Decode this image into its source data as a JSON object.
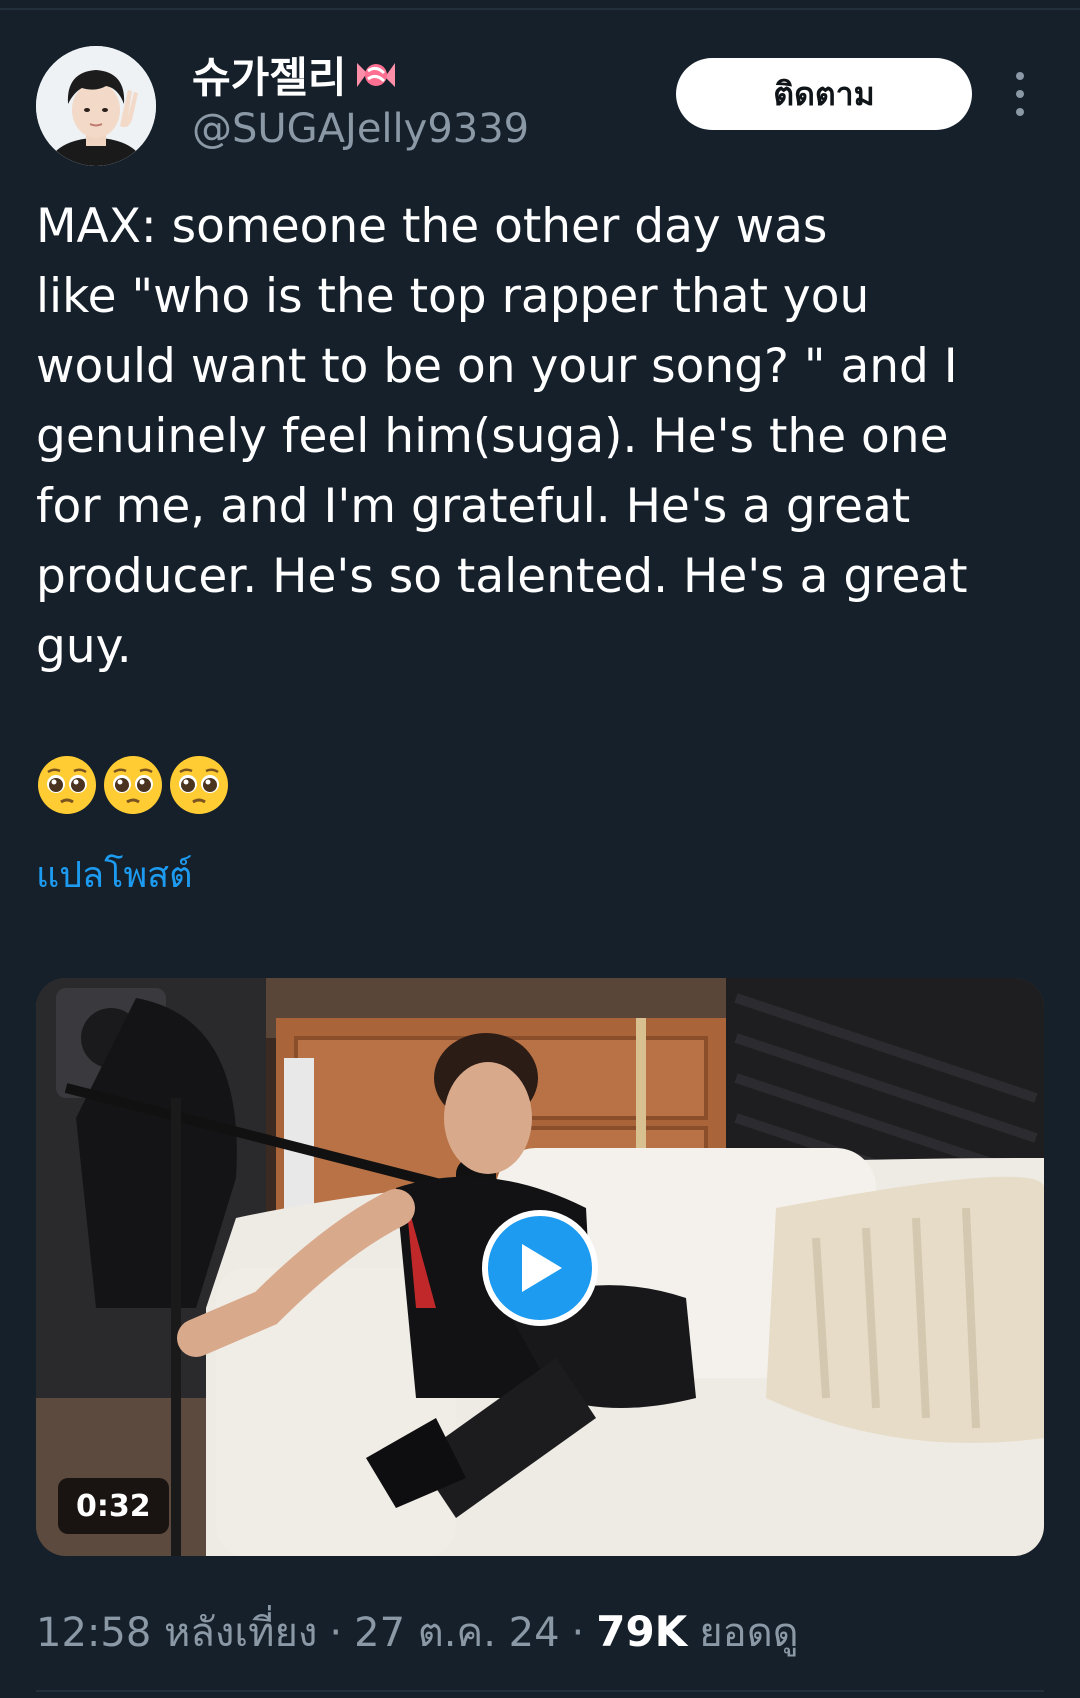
{
  "user": {
    "display_name": "슈가젤리",
    "display_emoji": "candy-emoji",
    "handle": "@SUGAJelly9339"
  },
  "header": {
    "follow_label": "ติดตาม",
    "more_icon": "more-vertical-icon"
  },
  "tweet": {
    "text": "MAX: someone the other day was\nlike \"who is the top rapper that you\nwould want to be on your song? \" and I\ngenuinely feel him(suga). He's the one\nfor me, and I'm grateful. He's a great\nproducer. He's so talented. He's a great\nguy.",
    "emojis": [
      "pleading-face-emoji",
      "pleading-face-emoji",
      "pleading-face-emoji"
    ],
    "translate_label": "แปลโพสต์"
  },
  "media": {
    "type": "video",
    "duration": "0:32",
    "play_icon": "play-icon"
  },
  "meta": {
    "time": "12:58 หลังเที่ยง",
    "separator": "·",
    "date": "27 ต.ค. 24",
    "views_count": "79K",
    "views_label": "ยอดดู"
  },
  "colors": {
    "background": "#15202b",
    "accent": "#1d9bf0",
    "secondary_text": "#8b98a5"
  }
}
